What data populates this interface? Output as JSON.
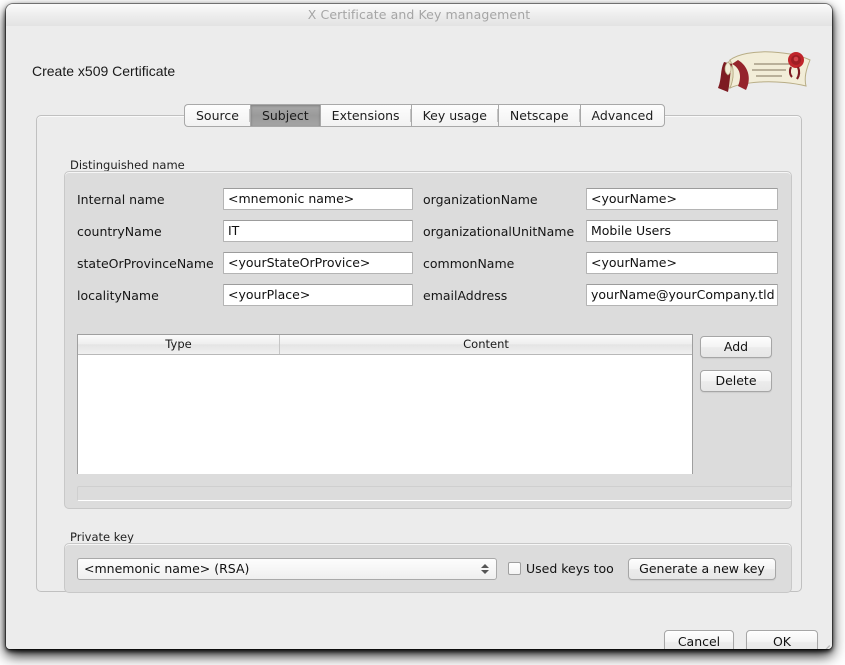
{
  "window": {
    "title": "X Certificate and Key management"
  },
  "header": {
    "heading": "Create x509 Certificate",
    "logo_icon": "certificate-scroll-logo"
  },
  "tabs": [
    {
      "label": "Source",
      "active": false
    },
    {
      "label": "Subject",
      "active": true
    },
    {
      "label": "Extensions",
      "active": false
    },
    {
      "label": "Key usage",
      "active": false
    },
    {
      "label": "Netscape",
      "active": false
    },
    {
      "label": "Advanced",
      "active": false
    }
  ],
  "distinguished_name": {
    "group_title": "Distinguished name",
    "left_fields": [
      {
        "label": "Internal name",
        "value": "<mnemonic name>"
      },
      {
        "label": "countryName",
        "value": "IT"
      },
      {
        "label": "stateOrProvinceName",
        "value": "<yourStateOrProvice>"
      },
      {
        "label": "localityName",
        "value": "<yourPlace>"
      }
    ],
    "right_fields": [
      {
        "label": "organizationName",
        "value": "<yourName>"
      },
      {
        "label": "organizationalUnitName",
        "value": "Mobile Users"
      },
      {
        "label": "commonName",
        "value": "<yourName>"
      },
      {
        "label": "emailAddress",
        "value": "yourName@yourCompany.tld"
      }
    ],
    "table": {
      "columns": [
        "Type",
        "Content"
      ],
      "rows": []
    },
    "add_label": "Add",
    "delete_label": "Delete"
  },
  "private_key": {
    "group_title": "Private key",
    "selected_key": "<mnemonic name> (RSA)",
    "used_keys_label": "Used keys too",
    "used_keys_checked": false,
    "generate_label": "Generate a new key"
  },
  "footer": {
    "cancel_label": "Cancel",
    "ok_label": "OK"
  },
  "colors": {
    "window_bg": "#ececec",
    "group_bg": "#dcdcdc",
    "active_tab": "#9f9f9f",
    "field_bg": "#ffffff",
    "title_text": "#a5a5a5",
    "logo_ribbon": "#7d1b22",
    "logo_rose": "#c0242b"
  }
}
